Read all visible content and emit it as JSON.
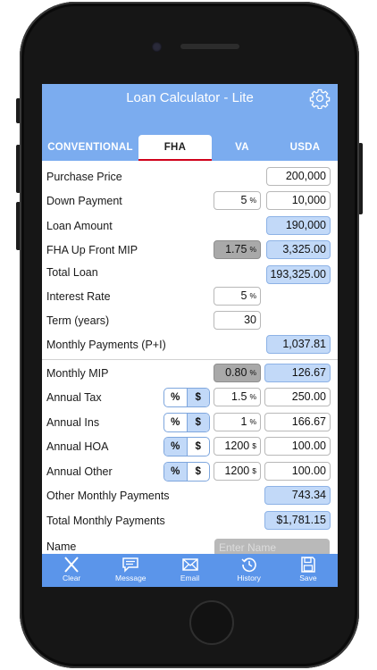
{
  "app": {
    "title": "Loan Calculator - Lite"
  },
  "tabs": [
    {
      "label": "CONVENTIONAL"
    },
    {
      "label": "FHA"
    },
    {
      "label": "VA"
    },
    {
      "label": "USDA"
    }
  ],
  "active_tab": "FHA",
  "form": {
    "purchase_price": {
      "label": "Purchase Price",
      "value": "200,000"
    },
    "down_payment": {
      "label": "Down Payment",
      "percent": "5",
      "percent_unit": "%",
      "value": "10,000"
    },
    "loan_amount": {
      "label": "Loan Amount",
      "value": "190,000"
    },
    "fha_mip": {
      "label": "FHA Up Front MIP",
      "percent": "1.75",
      "percent_unit": "%",
      "value": "3,325.00"
    },
    "total_loan": {
      "label": "Total Loan",
      "value": "193,325.00"
    },
    "interest_rate": {
      "label": "Interest Rate",
      "value": "5",
      "unit": "%"
    },
    "term": {
      "label": "Term (years)",
      "value": "30"
    },
    "monthly_payments": {
      "label": "Monthly Payments (P+I)",
      "value": "1,037.81"
    },
    "monthly_mip": {
      "label": "Monthly MIP",
      "percent": "0.80",
      "percent_unit": "%",
      "value": "126.67"
    },
    "annual_tax": {
      "label": "Annual Tax",
      "seg_a": "%",
      "seg_b": "$",
      "input": "1.5",
      "input_unit": "%",
      "value": "250.00"
    },
    "annual_ins": {
      "label": "Annual Ins",
      "seg_a": "%",
      "seg_b": "$",
      "input": "1",
      "input_unit": "%",
      "value": "166.67"
    },
    "annual_hoa": {
      "label": "Annual HOA",
      "seg_a": "%",
      "seg_b": "$",
      "input": "1200",
      "input_unit": "$",
      "value": "100.00"
    },
    "annual_other": {
      "label": "Annual Other",
      "seg_a": "%",
      "seg_b": "$",
      "input": "1200",
      "input_unit": "$",
      "value": "100.00"
    },
    "other_monthly": {
      "label": "Other Monthly Payments",
      "value": "743.34"
    },
    "total_monthly": {
      "label": "Total Monthly Payments",
      "value": "$1,781.15"
    },
    "name": {
      "label": "Name",
      "placeholder": "Enter Name"
    }
  },
  "toolbar": [
    {
      "label": "Clear",
      "icon": "close-icon"
    },
    {
      "label": "Message",
      "icon": "message-icon"
    },
    {
      "label": "Email",
      "icon": "email-icon"
    },
    {
      "label": "History",
      "icon": "history-icon"
    },
    {
      "label": "Save",
      "icon": "save-icon"
    }
  ],
  "colors": {
    "header": "#7bacef",
    "toolbar": "#5b95ea",
    "result_field": "#c2d9f8",
    "active_tab_underline": "#d0021b"
  }
}
